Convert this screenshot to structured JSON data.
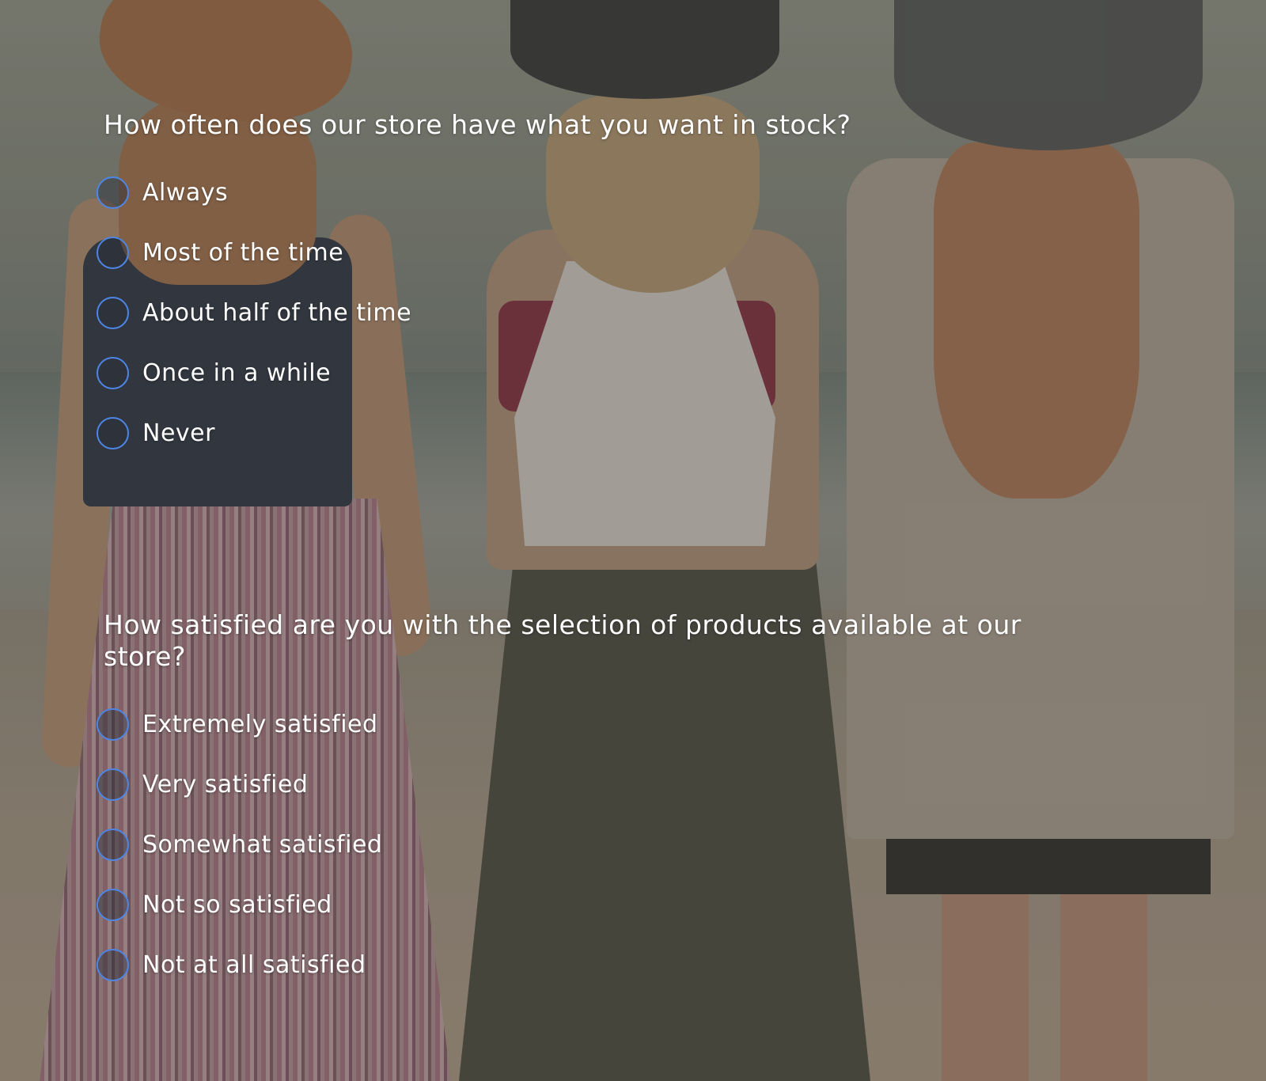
{
  "survey": {
    "questions": [
      {
        "text": "How often does our store have what you want in stock?",
        "options": [
          {
            "label": "Always"
          },
          {
            "label": "Most of the time"
          },
          {
            "label": "About half of the time"
          },
          {
            "label": "Once in a while"
          },
          {
            "label": "Never"
          }
        ]
      },
      {
        "text": "How satisfied are you with the selection of products available at our store?",
        "options": [
          {
            "label": "Extremely satisfied"
          },
          {
            "label": "Very satisfied"
          },
          {
            "label": "Somewhat satisfied"
          },
          {
            "label": "Not so satisfied"
          },
          {
            "label": "Not at all satisfied"
          }
        ]
      }
    ]
  },
  "theme": {
    "text_color": "#ffffff",
    "radio_border_color": "#4d86e6"
  }
}
